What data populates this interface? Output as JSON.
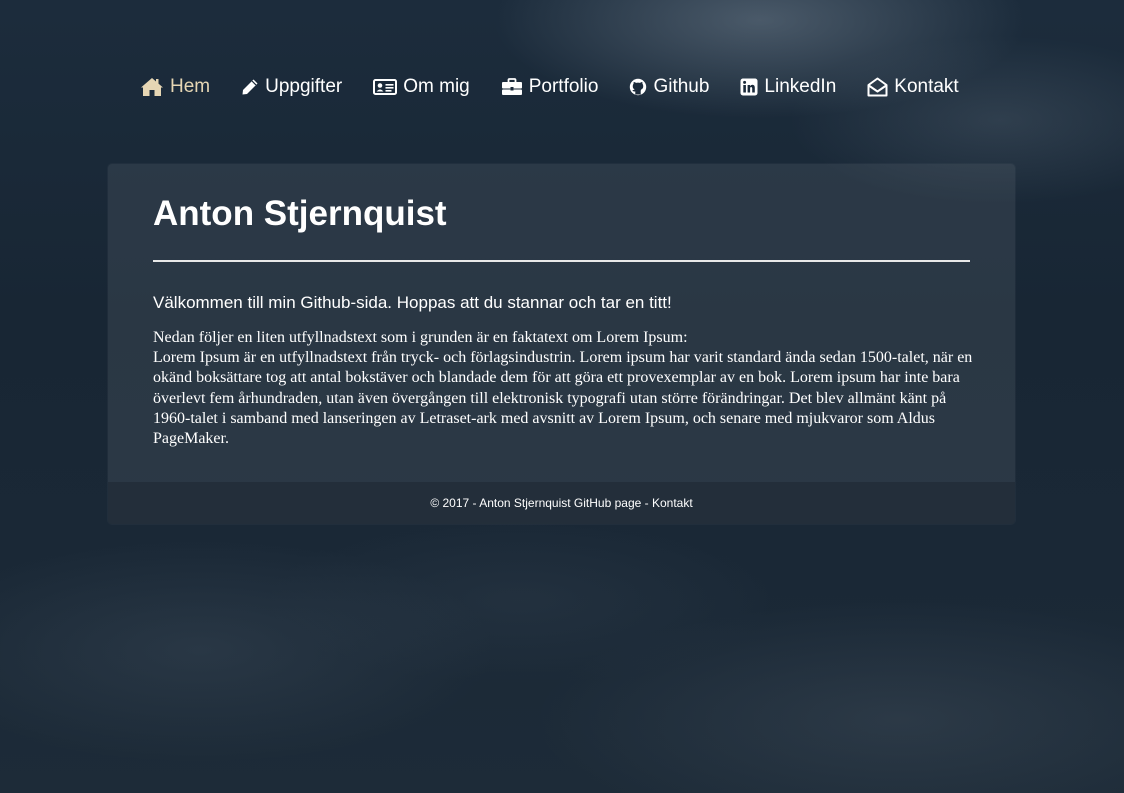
{
  "nav": {
    "items": [
      {
        "label": "Hem",
        "icon": "home-icon"
      },
      {
        "label": "Uppgifter",
        "icon": "pencil-icon"
      },
      {
        "label": "Om mig",
        "icon": "id-card-icon"
      },
      {
        "label": "Portfolio",
        "icon": "briefcase-icon"
      },
      {
        "label": "Github",
        "icon": "github-icon"
      },
      {
        "label": "LinkedIn",
        "icon": "linkedin-icon"
      },
      {
        "label": "Kontakt",
        "icon": "envelope-open-icon"
      }
    ],
    "active_color": "#e6d6b4"
  },
  "main": {
    "title": "Anton Stjernquist",
    "welcome": "Välkommen till min Github-sida. Hoppas att du stannar och tar en titt!",
    "intro": "Nedan följer en liten utfyllnadstext som i grunden är en faktatext om Lorem Ipsum:",
    "lorem": "Lorem Ipsum är en utfyllnadstext från tryck- och förlagsindustrin. Lorem ipsum har varit standard ända sedan 1500-talet, när en okänd boksättare tog att antal bokstäver och blandade dem för att göra ett provexemplar av en bok. Lorem ipsum har inte bara överlevt fem århundraden, utan även övergången till elektronisk typografi utan större förändringar. Det blev allmänt känt på 1960-talet i samband med lanseringen av Letraset-ark med avsnitt av Lorem Ipsum, och senare med mjukvaror som Aldus PageMaker."
  },
  "footer": {
    "copyright": "© 2017 - Anton Stjernquist GitHub page - ",
    "link": "Kontakt"
  }
}
